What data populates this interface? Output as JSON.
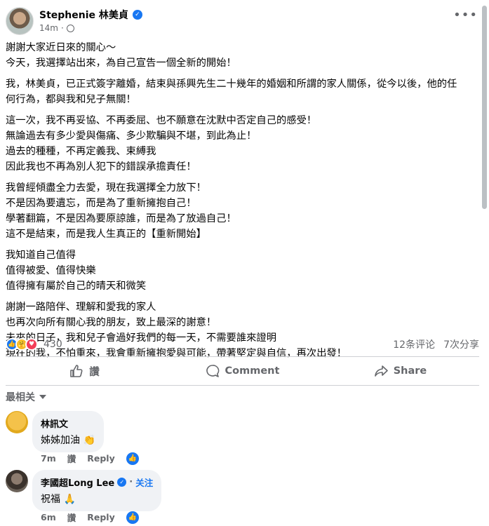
{
  "post": {
    "author": "Stephenie 林美貞",
    "time": "14m",
    "paragraphs": [
      [
        "謝謝大家近日來的關心～",
        "今天，我選擇站出來，為自己宣告一個全新的開始！"
      ],
      [
        "我，林美貞，已正式簽字離婚，結束與孫興先生二十幾年的婚姻和所謂的家人關係，從今以後，他的任",
        "何行為，都與我和兒子無關！"
      ],
      [
        "這一次，我不再妥協、不再委屈、也不願意在沈默中否定自己的感受！",
        "無論過去有多少愛與傷痛、多少欺騙與不堪，到此為止！",
        "過去的種種，不再定義我、束縛我",
        "因此我也不再為別人犯下的錯誤承擔責任！"
      ],
      [
        "我曾經傾盡全力去愛，現在我選擇全力放下！",
        "不是因為要遺忘，而是為了重新擁抱自己！",
        "學著翻篇，不是因為要原諒誰，而是為了放過自己！",
        "這不是結束，而是我人生真正的【重新開始】"
      ],
      [
        "我知道自己值得",
        "值得被愛、值得快樂",
        "值得擁有屬於自己的晴天和微笑"
      ],
      [
        "謝謝一路陪伴、理解和愛我的家人",
        "也再次向所有關心我的朋友，致上最深的謝意！",
        "未來的日子，我和兒子會過好我們的每一天，不需要誰來證明",
        "現在的我，不怕重來，我會重新擁抱愛與可能，帶著堅定與自信，再次出發！"
      ]
    ],
    "reaction_count": "430",
    "comments_count": "12条评论",
    "shares_count": "7次分享"
  },
  "actions": {
    "like": "讚",
    "comment": "Comment",
    "share": "Share"
  },
  "sort_label": "最相关",
  "comments": [
    {
      "name": "林訊文",
      "text": "姊姊加油",
      "emoji": "👏",
      "time": "7m",
      "like": "讚",
      "reply": "Reply",
      "follow": ""
    },
    {
      "name": "李國超Long Lee",
      "text": "祝福",
      "emoji": "🙏",
      "time": "6m",
      "like": "讚",
      "reply": "Reply",
      "follow": "关注"
    }
  ],
  "colors": {
    "accent": "#1877f2",
    "secondary_text": "#65676b",
    "bubble": "#f0f2f5",
    "love": "#f33e58",
    "care": "#f7b928"
  }
}
